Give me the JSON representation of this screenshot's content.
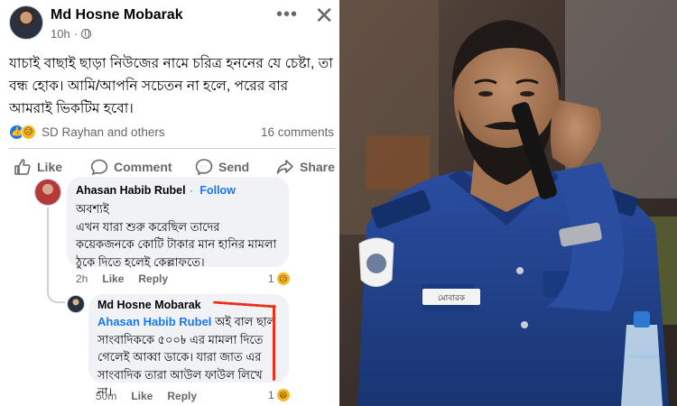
{
  "post": {
    "author": "Md Hosne Mobarak",
    "time": "10h",
    "text": "যাচাই বাছাই ছাড়া নিউজের নামে চরিত্র হননের যে চেষ্টা, তা বন্ধ হোক। আমি/আপনি সচেতন না হলে, পরের বার আমরাই ভিকটিম হবো।",
    "reactions_names": "SD Rayhan and others",
    "comments_count": "16 comments",
    "reaction_icons": [
      "like-icon",
      "sad-icon"
    ]
  },
  "actions": {
    "like": "Like",
    "comment": "Comment",
    "send": "Send",
    "share": "Share"
  },
  "comments": [
    {
      "author": "Ahasan Habib Rubel",
      "follow": "Follow",
      "text": "অবশ্যই\nএখন যারা শুরু করেছিল তাদের কয়েকজনকে কোটি টাকার মান হানির মামলা ঠুকে দিতে হলেই কেল্লাফতে।",
      "time": "2h",
      "like": "Like",
      "reply": "Reply",
      "reactions": "1"
    },
    {
      "author": "Md Hosne Mobarak",
      "mention": "Ahasan Habib Rubel",
      "text": " অই বাল ছাল সাংবাদিককে ৫০০৳ এর মামলা দিতে গেলেই আব্বা ডাকে। যারা জাত এর সাংবাদিক তারা আউল ফাউল লিখে না।",
      "time": "50m",
      "like": "Like",
      "reply": "Reply",
      "reactions": "1"
    }
  ],
  "photo": {
    "name_tag": "মোবারক",
    "colors": {
      "uniform": "#1f3f8a",
      "background": "#4a3a30"
    }
  }
}
